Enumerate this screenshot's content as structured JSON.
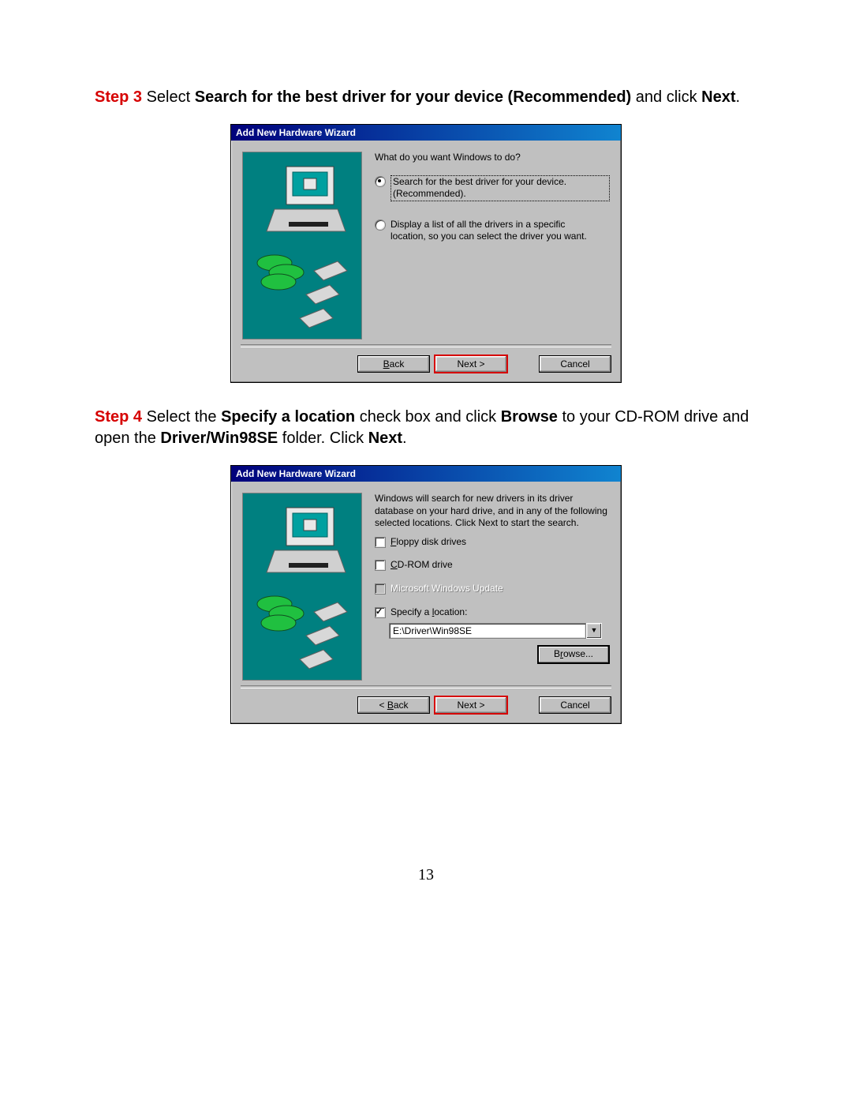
{
  "step3": {
    "label": "Step 3",
    "text_before": " Select ",
    "bold1": "Search for the best driver for your device (Recommended)",
    "text_mid": " and click ",
    "bold2": "Next",
    "text_after": "."
  },
  "dialog1": {
    "title": "Add New Hardware Wizard",
    "prompt": "What do you want Windows to do?",
    "opt1_line1": "Search for the best driver for your device.",
    "opt1_line2": "(Recommended).",
    "opt2_line1": "Display a list of all the drivers in a specific",
    "opt2_line2": "location, so you can select the driver you want.",
    "back": "< Back",
    "next": "Next >",
    "cancel": "Cancel"
  },
  "step4": {
    "label": "Step 4",
    "t1": " Select the ",
    "b1": "Specify a location",
    "t2": " check box and click ",
    "b2": "Browse",
    "t3": " to your CD-ROM drive and open the ",
    "b3": "Driver/Win98SE",
    "t4": " folder. Click ",
    "b4": "Next",
    "t5": "."
  },
  "dialog2": {
    "title": "Add New Hardware Wizard",
    "intro": "Windows will search for new drivers in its driver database on your hard drive, and in any of the following selected locations. Click Next to start the search.",
    "chk_floppy": "Floppy disk drives",
    "chk_cdrom": "CD-ROM drive",
    "chk_msupdate": "Microsoft Windows Update",
    "chk_location": "Specify a location:",
    "path": "E:\\Driver\\Win98SE",
    "browse": "Browse...",
    "back": "< Back",
    "next": "Next >",
    "cancel": "Cancel"
  },
  "page_number": "13"
}
